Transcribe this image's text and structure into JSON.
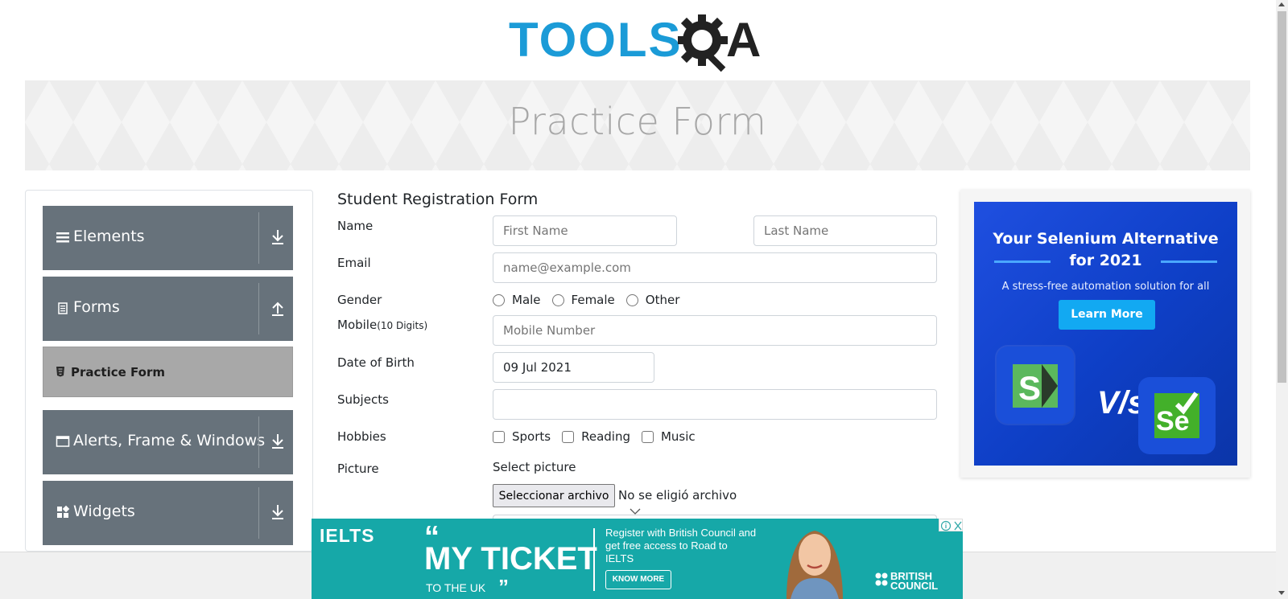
{
  "logo": {
    "text": "TOOLS",
    "letter": "A"
  },
  "banner": {
    "title": "Practice Form"
  },
  "sidebar": {
    "groups": [
      {
        "label": "Elements",
        "icon": "menu-icon",
        "arrow": "download-arrow-icon"
      },
      {
        "label": "Forms",
        "icon": "document-icon",
        "arrow": "upload-arrow-icon"
      },
      {
        "label": "Alerts, Frame & Windows",
        "icon": "window-icon",
        "arrow": "download-arrow-icon"
      },
      {
        "label": "Widgets",
        "icon": "widgets-icon",
        "arrow": "download-arrow-icon"
      }
    ],
    "active_item": {
      "label": "Practice Form",
      "icon": "html5-icon"
    }
  },
  "form": {
    "title": "Student Registration Form",
    "labels": {
      "name": "Name",
      "email": "Email",
      "gender": "Gender",
      "mobile": "Mobile",
      "mobile_hint": "(10 Digits)",
      "dob": "Date of Birth",
      "subjects": "Subjects",
      "hobbies": "Hobbies",
      "picture": "Picture"
    },
    "placeholders": {
      "first_name": "First Name",
      "last_name": "Last Name",
      "email": "name@example.com",
      "mobile": "Mobile Number"
    },
    "dob_value": "09 Jul 2021",
    "subjects_value": "",
    "gender_options": [
      "Male",
      "Female",
      "Other"
    ],
    "hobby_options": [
      "Sports",
      "Reading",
      "Music"
    ],
    "picture": {
      "prompt": "Select picture",
      "button": "Seleccionar archivo",
      "status": "No se eligió archivo"
    }
  },
  "ad_right": {
    "headline_1": "Your Selenium Alternative",
    "headline_2": "for 2021",
    "subline": "A stress-free automation solution for all",
    "button": "Learn More",
    "vs": "V/s",
    "logo_left": "S",
    "logo_right": "Se"
  },
  "ad_bottom": {
    "brand": "IELTS",
    "headline": "MY TICKET",
    "subline": "TO THE UK",
    "body": "Register with British Council and get free access to Road to IELTS",
    "button": "KNOW MORE",
    "sponsor_1": "BRITISH",
    "sponsor_2": "COUNCIL"
  },
  "colors": {
    "sidebar_group": "#67727b",
    "sidebar_active": "#a8a8a8",
    "logo_blue": "#1b9bd7",
    "ad_blue": "#1f4fe0",
    "ad_teal": "#16a8a8"
  }
}
